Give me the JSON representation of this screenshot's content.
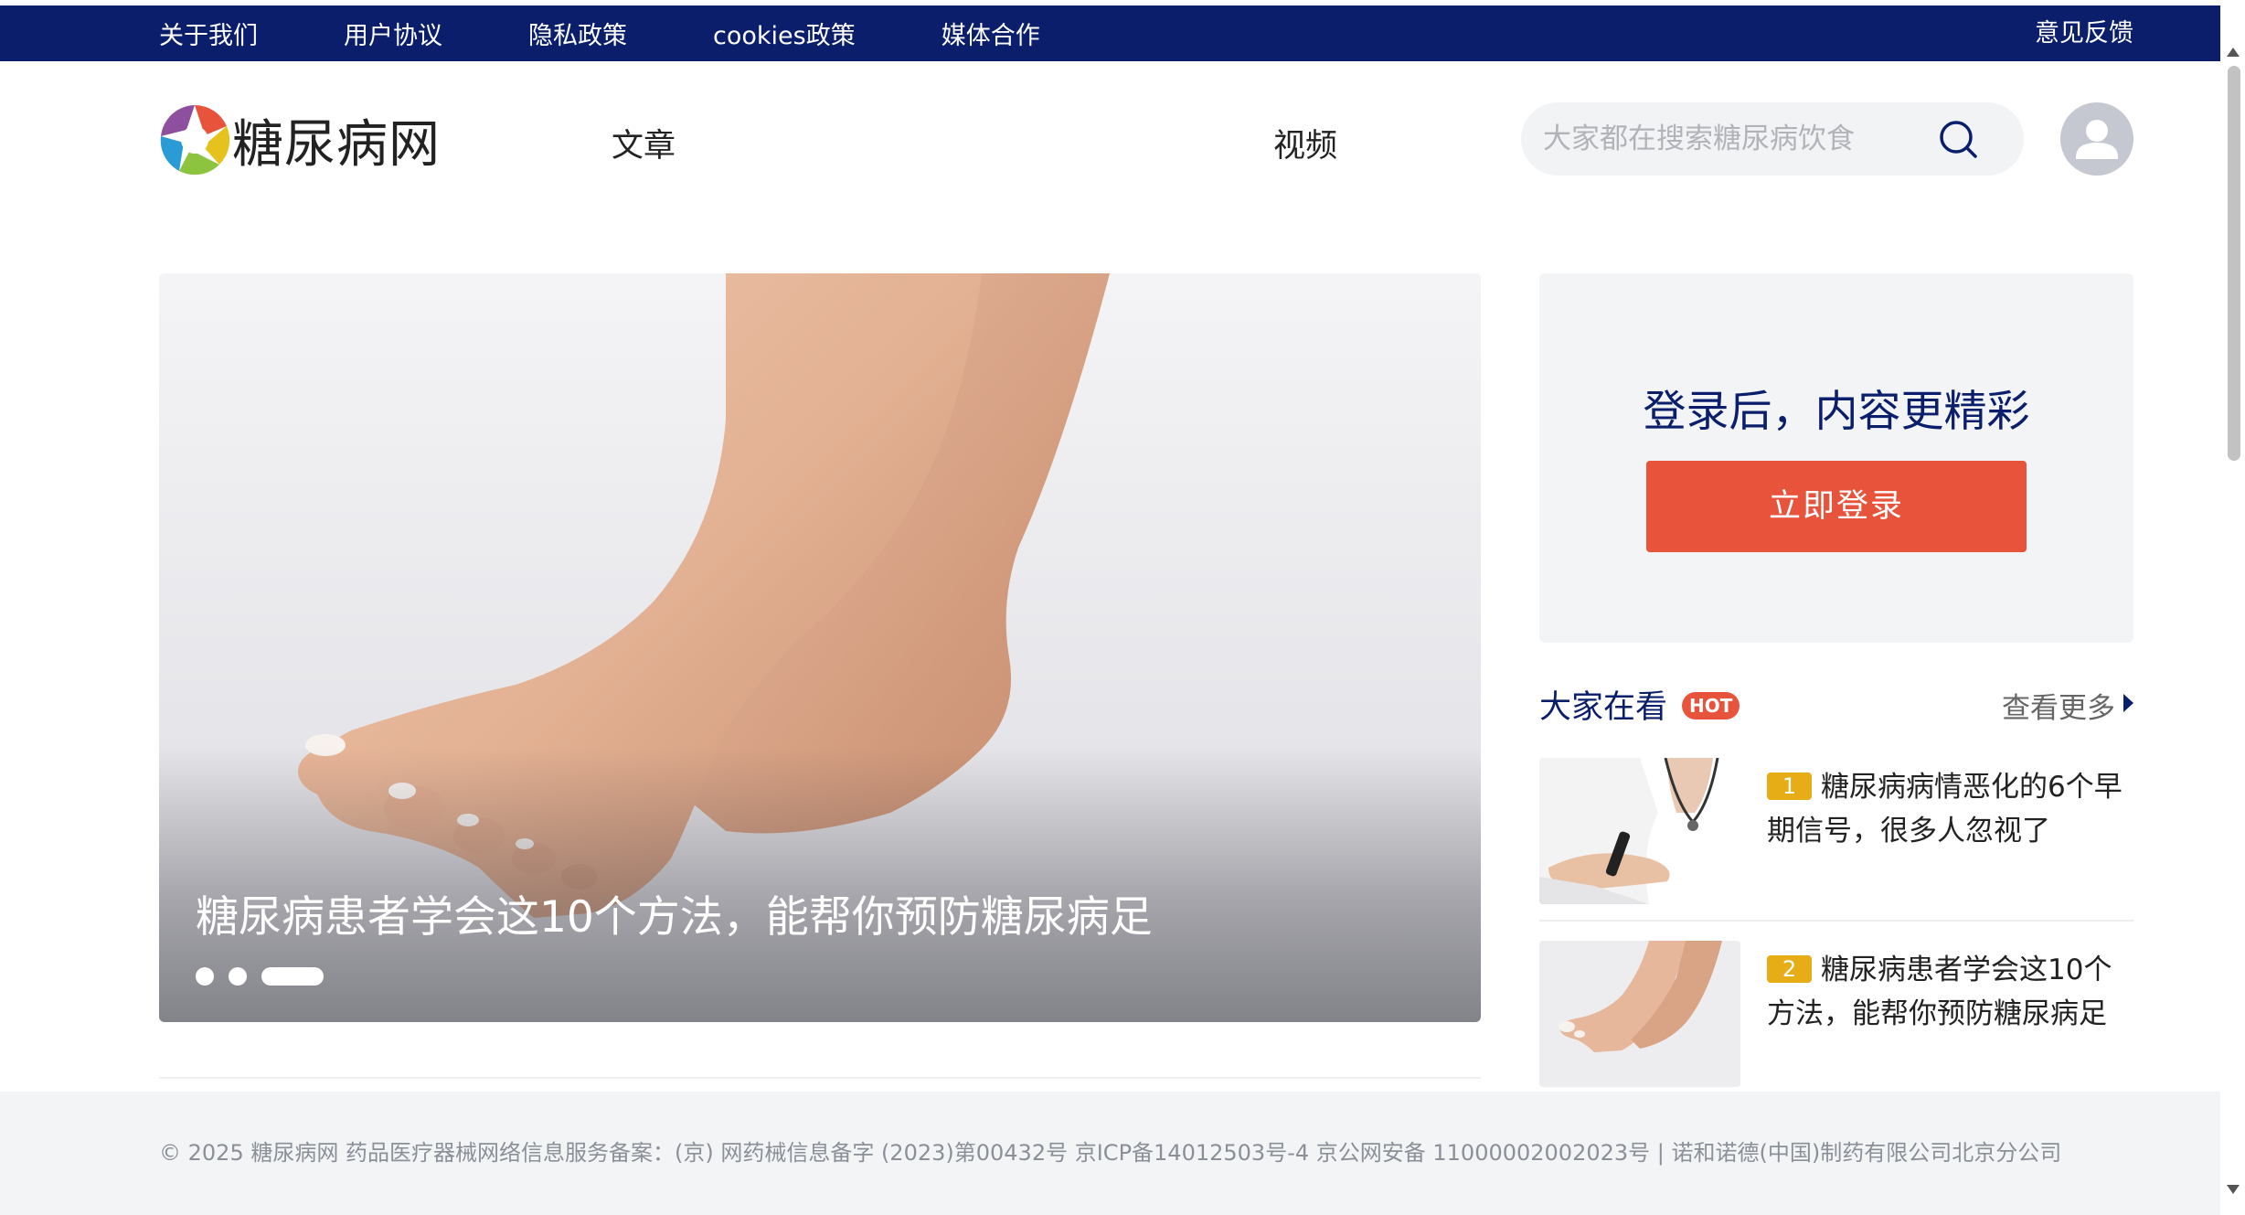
{
  "topbar": {
    "links": [
      "关于我们",
      "用户协议",
      "隐私政策",
      "cookies政策",
      "媒体合作"
    ],
    "feedback": "意见反馈"
  },
  "header": {
    "site_name": "糖尿病网",
    "nav": {
      "article": "文章",
      "video": "视频"
    },
    "search_placeholder": "大家都在搜索糖尿病饮食",
    "icons": {
      "search": "search-icon",
      "avatar": "user-avatar-icon"
    }
  },
  "banner": {
    "caption": "糖尿病患者学会这10个方法，能帮你预防糖尿病足",
    "slides": 3,
    "active_slide": 3
  },
  "login_card": {
    "title": "登录后，内容更精彩",
    "button": "立即登录"
  },
  "hot": {
    "title": "大家在看",
    "badge": "HOT",
    "more": "查看更多",
    "items": [
      {
        "rank": "1",
        "title": "糖尿病病情恶化的6个早期信号，很多人忽视了"
      },
      {
        "rank": "2",
        "title": "糖尿病患者学会这10个方法，能帮你预防糖尿病足"
      }
    ]
  },
  "footer": {
    "text": "© 2025 糖尿病网   药品医疗器械网络信息服务备案：(京) 网药械信息备字 (2023)第00432号   京ICP备14012503号-4   京公网安备 11000002002023号   |   诺和诺德(中国)制药有限公司北京分公司"
  },
  "colors": {
    "brand_navy": "#0a1e6b",
    "login_button": "#e8533c",
    "hot_badge": "#e8533c",
    "rank_badge": "#e6ad17"
  }
}
